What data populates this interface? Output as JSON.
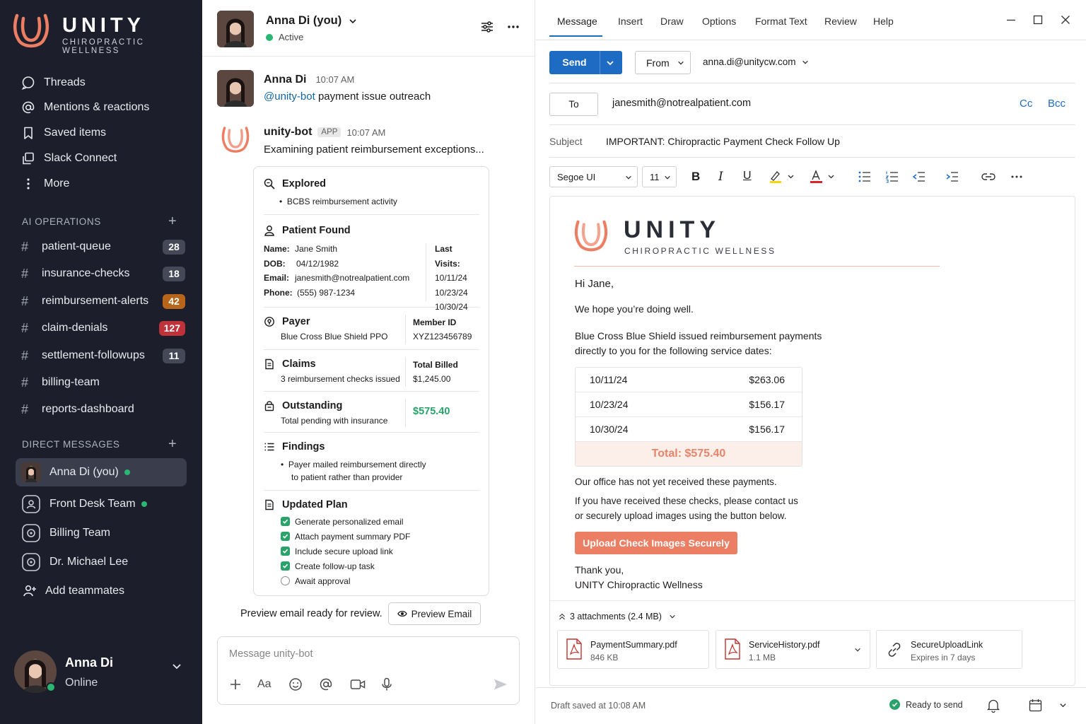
{
  "brand": {
    "name": "UNITY",
    "tagline": "CHIROPRACTIC WELLNESS"
  },
  "colors": {
    "accent": "#ec7e63",
    "sidebar": "#1c1f2b",
    "send": "#1e6bc4",
    "success": "#2aa36b"
  },
  "sidebar": {
    "nav": [
      {
        "label": "Threads",
        "icon": "threads-icon"
      },
      {
        "label": "Mentions & reactions",
        "icon": "at-icon"
      },
      {
        "label": "Saved items",
        "icon": "bookmark-icon"
      },
      {
        "label": "Slack Connect",
        "icon": "connect-icon"
      },
      {
        "label": "More",
        "icon": "more-vertical-icon"
      }
    ],
    "channels_header": "AI OPERATIONS",
    "channels": [
      {
        "name": "patient-queue",
        "badge": "28"
      },
      {
        "name": "insurance-checks",
        "badge": "18"
      },
      {
        "name": "reimbursement-alerts",
        "badge": "42"
      },
      {
        "name": "claim-denials",
        "badge": "127"
      },
      {
        "name": "settlement-followups",
        "badge": "11"
      },
      {
        "name": "billing-team",
        "badge": ""
      },
      {
        "name": "reports-dashboard",
        "badge": ""
      }
    ],
    "dm_header": "DIRECT MESSAGES",
    "dms": [
      {
        "name": "Anna Di (you)"
      },
      {
        "name": "Front Desk Team"
      },
      {
        "name": "Billing Team"
      },
      {
        "name": "Dr. Michael Lee"
      }
    ],
    "add_teammates": "Add teammates",
    "user": {
      "name": "Anna Di",
      "status": "Online"
    }
  },
  "chat": {
    "header": {
      "name": "Anna Di (you)",
      "status": "Active"
    },
    "messages": [
      {
        "author": "Anna Di",
        "time": "10:07 AM",
        "mention": "@unity-bot",
        "text": "payment issue outreach"
      },
      {
        "author": "unity-bot",
        "tag": "APP",
        "time": "10:07 AM",
        "text": "Examining patient reimbursement exceptions..."
      }
    ],
    "card": {
      "explored": {
        "title": "Explored",
        "item": "BCBS reimbursement activity"
      },
      "patient": {
        "title": "Patient Found",
        "labels": [
          "Name:",
          "DOB:",
          "Email:",
          "Phone:"
        ],
        "values": [
          "Jane Smith",
          "04/12/1982",
          "janesmith@notrealpatient.com",
          "(555) 987-1234"
        ],
        "visits_label": "Last Visits:",
        "visits": [
          "10/11/24",
          "10/23/24",
          "10/30/24"
        ]
      },
      "payer": {
        "title": "Payer",
        "value": "Blue Cross Blue Shield PPO",
        "member_label": "Member ID",
        "member_id": "XYZ123456789"
      },
      "claims": {
        "title": "Claims",
        "value": "3 reimbursement checks issued",
        "billed_label": "Total Billed",
        "billed": "$1,245.00"
      },
      "outstanding": {
        "title": "Outstanding",
        "value": "Total pending with insurance",
        "amount": "$575.40"
      },
      "findings": {
        "title": "Findings",
        "line1": "Payer mailed reimbursement directly",
        "line2": "to patient rather than provider"
      },
      "plan": {
        "title": "Updated Plan",
        "items": [
          {
            "label": "Generate personalized email",
            "done": true
          },
          {
            "label": "Attach payment summary PDF",
            "done": true
          },
          {
            "label": "Include secure upload link",
            "done": true
          },
          {
            "label": "Create follow-up task",
            "done": true
          },
          {
            "label": "Await approval",
            "done": false
          }
        ]
      }
    },
    "preview_text": "Preview email ready for review.",
    "preview_button": "Preview Email",
    "composer_placeholder": "Message unity-bot"
  },
  "email": {
    "tabs": [
      "Message",
      "Insert",
      "Draw",
      "Options",
      "Format Text",
      "Review",
      "Help"
    ],
    "send_label": "Send",
    "from_label": "From",
    "from_address": "anna.di@unitycw.com",
    "to_label": "To",
    "to_value": "janesmith@notrealpatient.com",
    "cc": "Cc",
    "bcc": "Bcc",
    "subject_label": "Subject",
    "subject": "IMPORTANT: Chiropractic Payment Check Follow Up",
    "font": "Segoe UI",
    "font_size": "11",
    "body": {
      "greeting": "Hi Jane,",
      "p1": "We hope you’re doing well.",
      "p2a": "Blue Cross Blue Shield issued reimbursement payments",
      "p2b": "directly to you for the following service dates:",
      "payments": [
        {
          "date": "10/11/24",
          "amount": "$263.06"
        },
        {
          "date": "10/23/24",
          "amount": "$156.17"
        },
        {
          "date": "10/30/24",
          "amount": "$156.17"
        }
      ],
      "total": "Total: $575.40",
      "p3": "Our office has not yet received these payments.",
      "p4a": "If you have received these checks, please contact us",
      "p4b": "or securely upload images using the button below.",
      "cta": "Upload Check Images Securely",
      "signoff": "Thank you,",
      "signature": "UNITY Chiropractic Wellness"
    },
    "attachments_summary": "3 attachments (2.4 MB)",
    "attachments": [
      {
        "name": "PaymentSummary.pdf",
        "size": "846 KB",
        "icon": "pdf-icon"
      },
      {
        "name": "ServiceHistory.pdf",
        "size": "1.1 MB",
        "icon": "pdf-icon"
      },
      {
        "name": "SecureUploadLink",
        "size": "Expires in 7 days",
        "icon": "link-icon"
      }
    ],
    "draft_status": "Draft saved at 10:08 AM",
    "ready_status": "Ready to send"
  }
}
